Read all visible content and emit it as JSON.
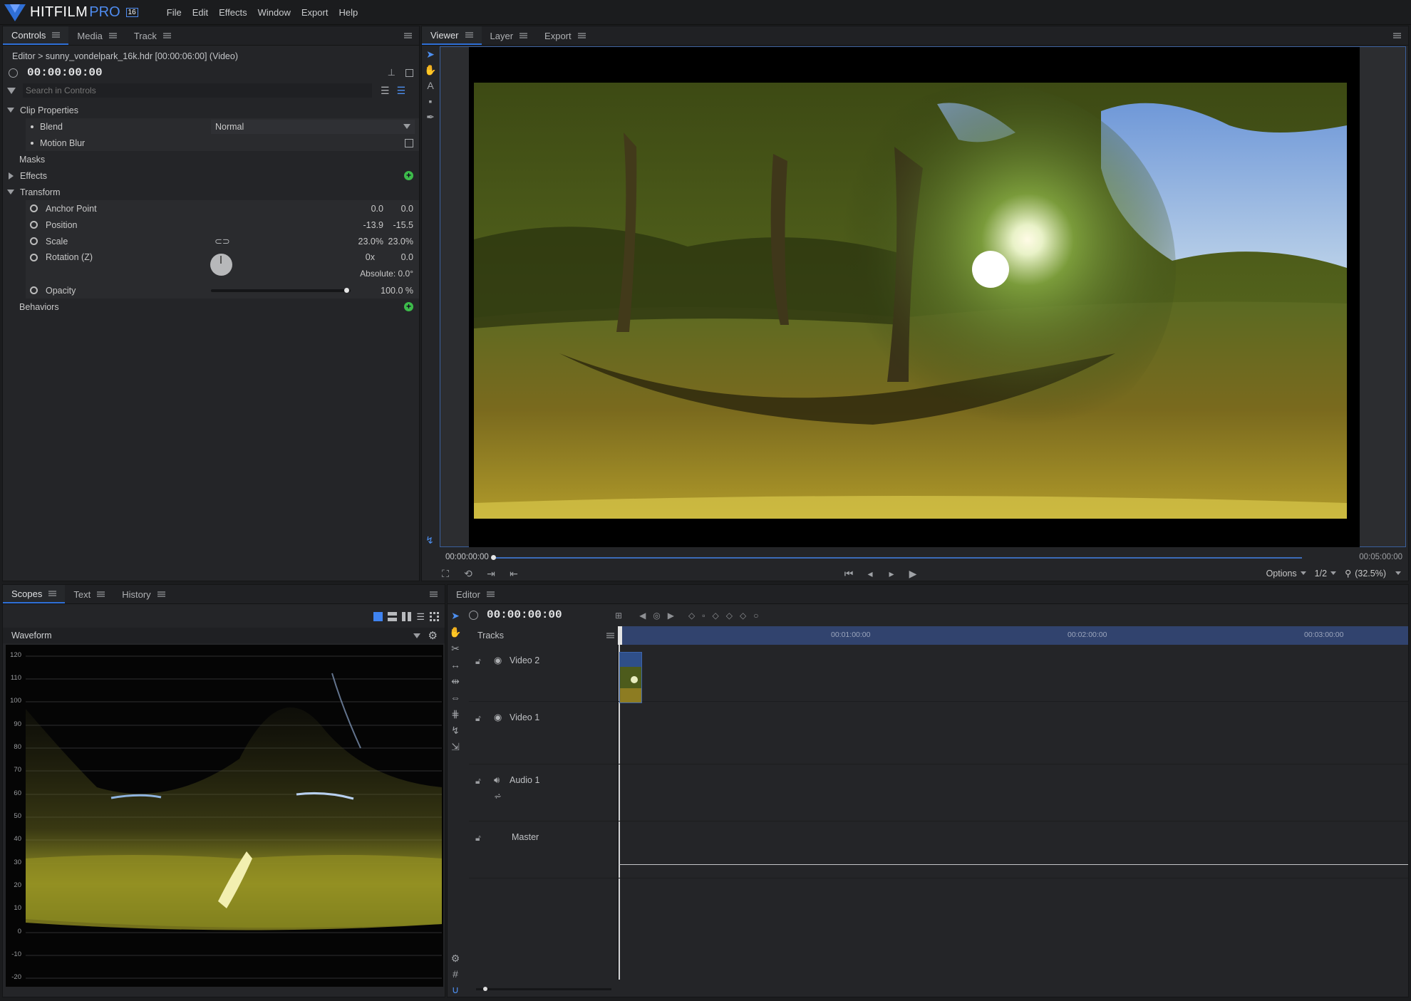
{
  "app": {
    "logo_text": "HITFILM",
    "logo_suffix": "PRO",
    "version_badge": "16",
    "accent": "#2f6fd6",
    "bg": "#232427"
  },
  "menu": [
    "File",
    "Edit",
    "Effects",
    "Window",
    "Export",
    "Help"
  ],
  "left_top": {
    "tabs": [
      "Controls",
      "Media",
      "Track"
    ],
    "active_tab": "Controls",
    "breadcrumb": "Editor > sunny_vondelpark_16k.hdr [00:00:06:00] (Video)",
    "timecode": "00:00:00:00",
    "search_placeholder": "Search in Controls",
    "clip_properties": "Clip Properties",
    "blend_label": "Blend",
    "blend_value": "Normal",
    "motion_blur_label": "Motion Blur",
    "masks_label": "Masks",
    "effects_label": "Effects",
    "transform_label": "Transform",
    "anchor_label": "Anchor Point",
    "anchor_x": "0.0",
    "anchor_y": "0.0",
    "position_label": "Position",
    "position_x": "-13.9",
    "position_y": "-15.5",
    "scale_label": "Scale",
    "scale_x": "23.0%",
    "scale_y": "23.0%",
    "rotation_label": "Rotation (Z)",
    "rotation_turns": "0x",
    "rotation_deg": "0.0",
    "rotation_absolute": "Absolute: 0.0°",
    "opacity_label": "Opacity",
    "opacity_value": "100.0 %",
    "opacity_level": 1.0,
    "behaviors_label": "Behaviors"
  },
  "viewer": {
    "tabs": [
      "Viewer",
      "Layer",
      "Export"
    ],
    "active_tab": "Viewer",
    "time_start": "00:00:00:00",
    "time_end": "00:05:00:00",
    "options_label": "Options",
    "resolution": "1/2",
    "zoom": "(32.5%)"
  },
  "scopes": {
    "tabs": [
      "Scopes",
      "Text",
      "History"
    ],
    "active_tab": "Scopes",
    "scope_type": "Waveform",
    "y_ticks": [
      "120",
      "110",
      "100",
      "90",
      "80",
      "70",
      "60",
      "50",
      "40",
      "30",
      "20",
      "10",
      "0",
      "-10",
      "-20"
    ]
  },
  "editor": {
    "tab": "Editor",
    "timecode": "00:00:00:00",
    "tracks_label": "Tracks",
    "ruler_marks": [
      "00:01:00:00",
      "00:02:00:00",
      "00:03:00:00"
    ],
    "tracks": [
      {
        "name": "Video 2",
        "type": "video"
      },
      {
        "name": "Video 1",
        "type": "video"
      },
      {
        "name": "Audio 1",
        "type": "audio"
      },
      {
        "name": "Master",
        "type": "master"
      }
    ]
  }
}
